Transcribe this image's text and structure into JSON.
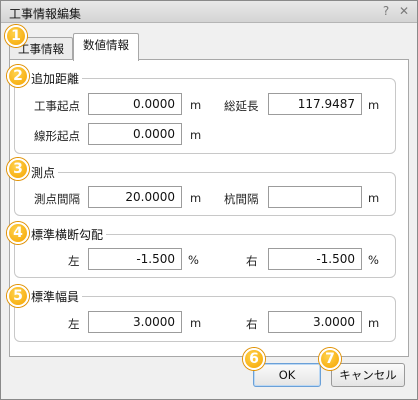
{
  "window": {
    "title": "工事情報編集",
    "help_glyph": "?",
    "close_glyph": "✕"
  },
  "badges": [
    "1",
    "2",
    "3",
    "4",
    "5",
    "6",
    "7"
  ],
  "tabs": [
    {
      "label": "工事情報",
      "active": false
    },
    {
      "label": "数値情報",
      "active": true
    }
  ],
  "additional_distance": {
    "legend": "追加距離",
    "start_label": "工事起点",
    "start_value": "0.0000",
    "start_unit": "m",
    "total_label": "総延長",
    "total_value": "117.9487",
    "total_unit": "m",
    "linear_label": "線形起点",
    "linear_value": "0.0000",
    "linear_unit": "m"
  },
  "survey_points": {
    "legend": "測点",
    "interval_label": "測点間隔",
    "interval_value": "20.0000",
    "interval_unit": "m",
    "stake_label": "杭間隔",
    "stake_value": "",
    "stake_unit": "m"
  },
  "cross_slope": {
    "legend": "標準横断勾配",
    "left_label": "左",
    "left_value": "-1.500",
    "left_unit": "%",
    "right_label": "右",
    "right_value": "-1.500",
    "right_unit": "%"
  },
  "width": {
    "legend": "標準幅員",
    "left_label": "左",
    "left_value": "3.0000",
    "left_unit": "m",
    "right_label": "右",
    "right_value": "3.0000",
    "right_unit": "m"
  },
  "buttons": {
    "ok": "OK",
    "cancel": "キャンセル"
  },
  "colors": {
    "badge": "#f5a400",
    "ok_border": "#6aa0d8"
  }
}
